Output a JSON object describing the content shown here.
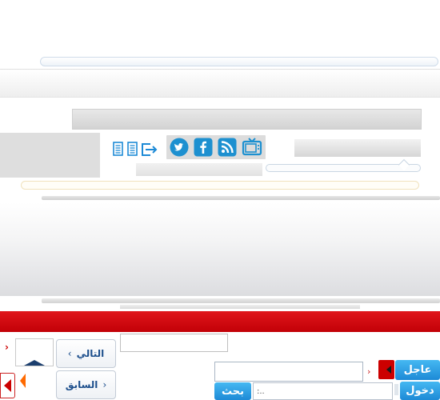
{
  "navigation": {
    "next_label": "التالي",
    "next_chevron": "›",
    "prev_label": "السابق",
    "prev_chevron": "‹"
  },
  "ticker": {
    "breaking_label": "عاجل",
    "chevron": "›"
  },
  "login": {
    "login_label": "دخول",
    "search_label": "بحث",
    "search_value": ":.."
  },
  "social_icons": [
    "twitter-icon",
    "facebook-icon",
    "rss-icon",
    "tv-icon"
  ],
  "doc_icons": [
    "document-icon",
    "document-list-icon",
    "logout-icon"
  ],
  "colors": {
    "brand_red": "#d0070d",
    "accent_blue": "#1d8ad6",
    "nav_text": "#1d4f8c",
    "orange": "#ff6a00"
  },
  "left_arrow": "‹"
}
